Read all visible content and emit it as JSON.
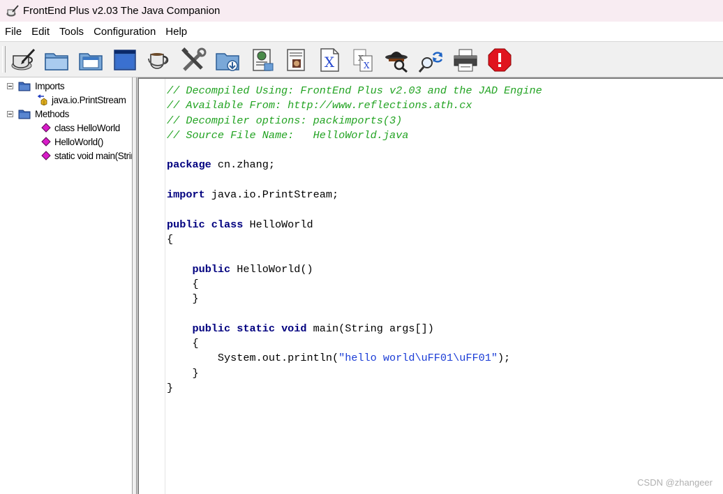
{
  "window": {
    "title": "FrontEnd Plus v2.03 The Java Companion",
    "icon": "coffee-cup-pen-icon"
  },
  "menu": [
    "File",
    "Edit",
    "Tools",
    "Configuration",
    "Help"
  ],
  "toolbar": {
    "buttons": [
      "decompile-icon",
      "open-folder-icon",
      "open-project-icon",
      "new-window-icon",
      "coffee-cup-icon",
      "tools-icon",
      "save-icon",
      "properties-icon",
      "document-view-icon",
      "class-file-icon",
      "batch-class-icon",
      "spy-icon",
      "search-replace-icon",
      "print-icon",
      "stop-icon"
    ]
  },
  "tree": {
    "imports_label": "Imports",
    "imports": [
      "java.io.PrintStream"
    ],
    "methods_label": "Methods",
    "methods": [
      "class HelloWorld",
      "HelloWorld()",
      "static void main(String[])"
    ]
  },
  "code": {
    "lines": [
      [
        {
          "t": "// Decompiled Using: FrontEnd Plus v2.03 and the JAD Engine",
          "c": "comment"
        }
      ],
      [
        {
          "t": "// Available From: http://www.reflections.ath.cx",
          "c": "comment"
        }
      ],
      [
        {
          "t": "// Decompiler options: packimports(3)",
          "c": "comment"
        }
      ],
      [
        {
          "t": "// Source File Name:   HelloWorld.java",
          "c": "comment"
        }
      ],
      [],
      [
        {
          "t": "package",
          "c": "kw"
        },
        {
          "t": " cn.zhang;",
          "c": "plain"
        }
      ],
      [],
      [
        {
          "t": "import",
          "c": "kw"
        },
        {
          "t": " java.io.PrintStream;",
          "c": "plain"
        }
      ],
      [],
      [
        {
          "t": "public class",
          "c": "kw"
        },
        {
          "t": " HelloWorld",
          "c": "plain"
        }
      ],
      [
        {
          "t": "{",
          "c": "plain"
        }
      ],
      [],
      [
        {
          "t": "    ",
          "c": "plain"
        },
        {
          "t": "public",
          "c": "kw"
        },
        {
          "t": " HelloWorld()",
          "c": "plain"
        }
      ],
      [
        {
          "t": "    {",
          "c": "plain"
        }
      ],
      [
        {
          "t": "    }",
          "c": "plain"
        }
      ],
      [],
      [
        {
          "t": "    ",
          "c": "plain"
        },
        {
          "t": "public static void",
          "c": "kw"
        },
        {
          "t": " main(String args[])",
          "c": "plain"
        }
      ],
      [
        {
          "t": "    {",
          "c": "plain"
        }
      ],
      [
        {
          "t": "        System.out.println(",
          "c": "plain"
        },
        {
          "t": "\"hello world\\uFF01\\uFF01\"",
          "c": "str"
        },
        {
          "t": ");",
          "c": "plain"
        }
      ],
      [
        {
          "t": "    }",
          "c": "plain"
        }
      ],
      [
        {
          "t": "}",
          "c": "plain"
        }
      ]
    ]
  },
  "watermark": "CSDN @zhangeer"
}
